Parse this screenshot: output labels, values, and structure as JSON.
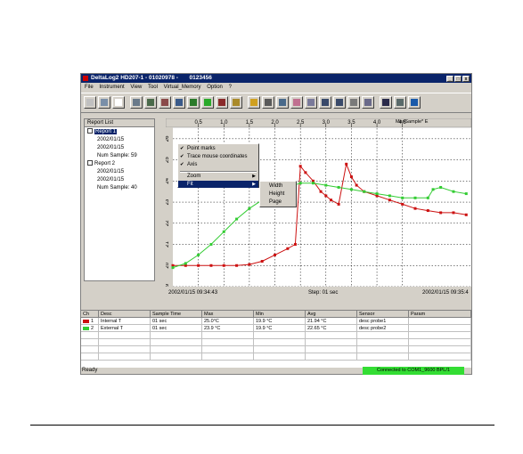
{
  "window": {
    "title": "DeltaLog2 HD207-1 - 01020978 -       0123456",
    "controls": [
      "_",
      "□",
      "x"
    ]
  },
  "menu": [
    "File",
    "Instrument",
    "View",
    "Tool",
    "Virtual_Memory",
    "Option",
    "?"
  ],
  "toolbar_icons": [
    "report-icon",
    "save-icon",
    "new-icon",
    "print-preview-icon",
    "instrument-icon",
    "download-icon",
    "connect-icon",
    "record-icon",
    "play-icon",
    "stop-icon",
    "export-icon",
    "table-icon",
    "chart-icon",
    "filter-icon",
    "line-chart-icon",
    "grid-icon",
    "zoom-in-icon",
    "zoom-out-icon",
    "marker-icon",
    "calc-icon",
    "printer-icon",
    "probe-icon",
    "exit-icon"
  ],
  "report_list": {
    "header": "Report List",
    "items": [
      {
        "label": "Report 1",
        "selected": true
      },
      {
        "label": "2002/01/15"
      },
      {
        "label": "2002/01/15"
      },
      {
        "label": "Num Sample: 59"
      },
      {
        "label": "Report 2"
      },
      {
        "label": "2002/01/15"
      },
      {
        "label": "2002/01/15"
      },
      {
        "label": "Num Sample: 40"
      }
    ]
  },
  "chart_ruler": {
    "ticks": [
      "0.5",
      "1.0",
      "1.5",
      "2.0",
      "2.5",
      "3.0",
      "3.5",
      "4.0",
      "4.5"
    ],
    "max_sample": "MaxSample*  E"
  },
  "context_menu": {
    "items": [
      {
        "label": "Point marks",
        "checked": true
      },
      {
        "label": "Trace mouse coordinates",
        "checked": true
      },
      {
        "label": "Axis",
        "checked": true
      },
      {
        "label": "Zoom",
        "submenu": true
      },
      {
        "label": "Fit",
        "submenu": true,
        "highlighted": true
      }
    ],
    "fit_submenu": [
      "Width",
      "Height",
      "Page"
    ]
  },
  "chart_data": {
    "type": "line",
    "x_labels": [
      "0.5",
      "1.0",
      "1.5",
      "2.0",
      "2.5",
      "3.0",
      "3.5",
      "4.0",
      "4.5"
    ],
    "y_labels": [
      "19",
      "20",
      "21",
      "22",
      "23",
      "24",
      "25",
      "26"
    ],
    "ylim": [
      19,
      26.5
    ],
    "grid": true,
    "series": [
      {
        "name": "Internal T",
        "color": "#cc1111",
        "x": [
          0,
          0.25,
          0.5,
          0.75,
          1.0,
          1.25,
          1.5,
          1.75,
          2.0,
          2.25,
          2.4,
          2.5,
          2.6,
          2.75,
          2.9,
          3.0,
          3.1,
          3.25,
          3.4,
          3.5,
          3.6,
          3.75,
          4.0,
          4.25,
          4.5,
          4.75,
          5.0,
          5.25,
          5.5,
          5.75
        ],
        "y": [
          20,
          20,
          20,
          20,
          20,
          20,
          20.05,
          20.2,
          20.5,
          20.8,
          21.0,
          24.7,
          24.4,
          24.0,
          23.5,
          23.3,
          23.1,
          22.9,
          24.8,
          24.2,
          23.8,
          23.5,
          23.3,
          23.1,
          22.9,
          22.7,
          22.6,
          22.5,
          22.5,
          22.4
        ]
      },
      {
        "name": "External T",
        "color": "#33cc33",
        "x": [
          0,
          0.25,
          0.5,
          0.75,
          1.0,
          1.25,
          1.5,
          1.75,
          2.0,
          2.25,
          2.5,
          2.75,
          3.0,
          3.25,
          3.5,
          3.75,
          4.0,
          4.25,
          4.5,
          4.75,
          5.0,
          5.1,
          5.25,
          5.5,
          5.75
        ],
        "y": [
          19.9,
          20.1,
          20.5,
          21.0,
          21.6,
          22.2,
          22.7,
          23.1,
          23.5,
          23.7,
          23.9,
          23.9,
          23.8,
          23.7,
          23.6,
          23.5,
          23.4,
          23.3,
          23.2,
          23.2,
          23.2,
          23.6,
          23.7,
          23.5,
          23.4
        ]
      }
    ]
  },
  "timeline": {
    "start": "2002/01/15 09:34:43",
    "step": "Step: 01 sec",
    "end": "2002/01/15 09:35:4"
  },
  "grid": {
    "headers": [
      "Ch",
      "Desc",
      "Sample Time",
      "Max",
      "Min",
      "Avg",
      "Sensor",
      "Param"
    ],
    "rows": [
      {
        "ch": "1",
        "color": "#cc1111",
        "desc": "Internal T",
        "sample_time": "01 sec",
        "max": "25.0°C",
        "min": "19.9 °C",
        "avg": "21.94 °C",
        "sensor": "desc probe1",
        "param": ""
      },
      {
        "ch": "2",
        "color": "#33cc33",
        "desc": "External T",
        "sample_time": "01 sec",
        "max": "23.9 °C",
        "min": "19.9 °C",
        "avg": "22.65 °C",
        "sensor": "desc probe2",
        "param": ""
      }
    ]
  },
  "status": {
    "left": "Ready",
    "connection": "Connected to COM1_9600 BPL/1"
  }
}
